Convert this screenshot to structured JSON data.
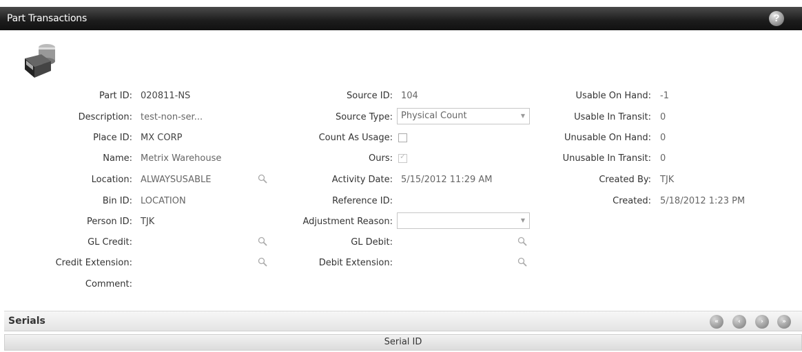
{
  "window": {
    "title": "Part Transactions",
    "help_icon": "?"
  },
  "col1": {
    "part_id": {
      "label": "Part ID:",
      "value": "020811-NS"
    },
    "description": {
      "label": "Description:",
      "value": "test-non-ser..."
    },
    "place_id": {
      "label": "Place ID:",
      "value": "MX CORP"
    },
    "name": {
      "label": "Name:",
      "value": "Metrix Warehouse"
    },
    "location": {
      "label": "Location:",
      "value": "ALWAYSUSABLE"
    },
    "bin_id": {
      "label": "Bin ID:",
      "value": "LOCATION"
    },
    "person_id": {
      "label": "Person ID:",
      "value": "TJK"
    },
    "gl_credit": {
      "label": "GL Credit:",
      "value": ""
    },
    "credit_extension": {
      "label": "Credit Extension:",
      "value": ""
    },
    "comment": {
      "label": "Comment:",
      "value": ""
    }
  },
  "col2": {
    "source_id": {
      "label": "Source ID:",
      "value": "104"
    },
    "source_type": {
      "label": "Source Type:",
      "value": "Physical Count"
    },
    "count_as_usage": {
      "label": "Count As Usage:",
      "checked": false
    },
    "ours": {
      "label": "Ours:",
      "checked": true
    },
    "activity_date": {
      "label": "Activity Date:",
      "value": "5/15/2012 11:29 AM"
    },
    "reference_id": {
      "label": "Reference ID:",
      "value": ""
    },
    "adjustment_reason": {
      "label": "Adjustment Reason:",
      "value": ""
    },
    "gl_debit": {
      "label": "GL Debit:",
      "value": ""
    },
    "debit_extension": {
      "label": "Debit Extension:",
      "value": ""
    }
  },
  "col3": {
    "usable_on_hand": {
      "label": "Usable On Hand:",
      "value": "-1"
    },
    "usable_in_transit": {
      "label": "Usable In Transit:",
      "value": "0"
    },
    "unusable_on_hand": {
      "label": "Unusable On Hand:",
      "value": "0"
    },
    "unusable_in_transit": {
      "label": "Unusable In Transit:",
      "value": "0"
    },
    "created_by": {
      "label": "Created By:",
      "value": "TJK"
    },
    "created": {
      "label": "Created:",
      "value": "5/18/2012 1:23 PM"
    }
  },
  "serials": {
    "title": "Serials",
    "nav": {
      "first": "«",
      "prev": "‹",
      "next": "›",
      "last": "»"
    },
    "columns": [
      "Serial ID"
    ]
  },
  "icons": {
    "part": "part-transaction-icon",
    "lookup": "magnifier-icon",
    "dropdown": "chevron-down-icon",
    "check": "✓"
  }
}
